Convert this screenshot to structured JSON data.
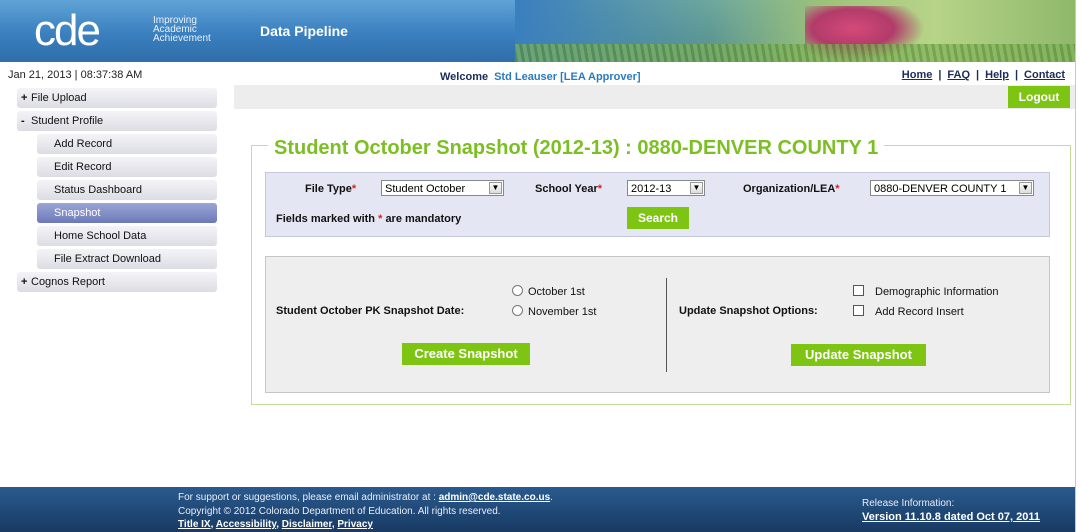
{
  "header": {
    "logo": "cde",
    "tagline": [
      "Improving",
      "Academic",
      "Achievement"
    ],
    "app_name": "Data Pipeline"
  },
  "datestamp": "Jan 21, 2013 | 08:37:38 AM",
  "welcome": {
    "label": "Welcome",
    "user": "Std Leauser [LEA Approver]"
  },
  "top_links": [
    "Home",
    "FAQ",
    "Help",
    "Contact"
  ],
  "logout_label": "Logout",
  "sidebar": {
    "items": [
      {
        "label": "File Upload",
        "toggle": "+"
      },
      {
        "label": "Student Profile",
        "toggle": "-"
      },
      {
        "label": "Cognos Report",
        "toggle": "+"
      }
    ],
    "sub_items": [
      "Add Record",
      "Edit Record",
      "Status Dashboard",
      "Snapshot",
      "Home School Data",
      "File Extract Download"
    ],
    "active": "Snapshot"
  },
  "main": {
    "title": "Student October Snapshot (2012-13) : 0880-DENVER COUNTY 1",
    "filters": {
      "file_type_label": "File Type",
      "file_type_value": "Student October",
      "school_year_label": "School Year",
      "school_year_value": "2012-13",
      "org_label": "Organization/LEA",
      "org_value": "0880-DENVER COUNTY 1",
      "required_marker": "*",
      "mandatory_note_pre": "Fields marked with",
      "mandatory_note_post": "are mandatory",
      "search_label": "Search"
    },
    "snapshot": {
      "date_label": "Student October PK Snapshot Date:",
      "date_options": [
        "October 1st",
        "November 1st"
      ],
      "create_label": "Create Snapshot",
      "update_label": "Update Snapshot Options:",
      "update_options": [
        "Demographic Information",
        "Add Record Insert"
      ],
      "update_button": "Update Snapshot"
    }
  },
  "footer": {
    "support_text": "For support or suggestions, please email administrator at :",
    "support_email": "admin@cde.state.co.us",
    "copyright": "Copyright © 2012 Colorado Department of Education. All rights reserved.",
    "links": [
      "Title IX",
      "Accessibility",
      "Disclaimer",
      "Privacy"
    ],
    "release_title": "Release Information:",
    "release_version": "Version 11.10.8 dated Oct 07, 2011"
  },
  "colors": {
    "accent_green": "#7ec413",
    "title_green": "#7cbf23",
    "header_blue": "#3a7fbf",
    "active_nav": "#6c79b8"
  }
}
